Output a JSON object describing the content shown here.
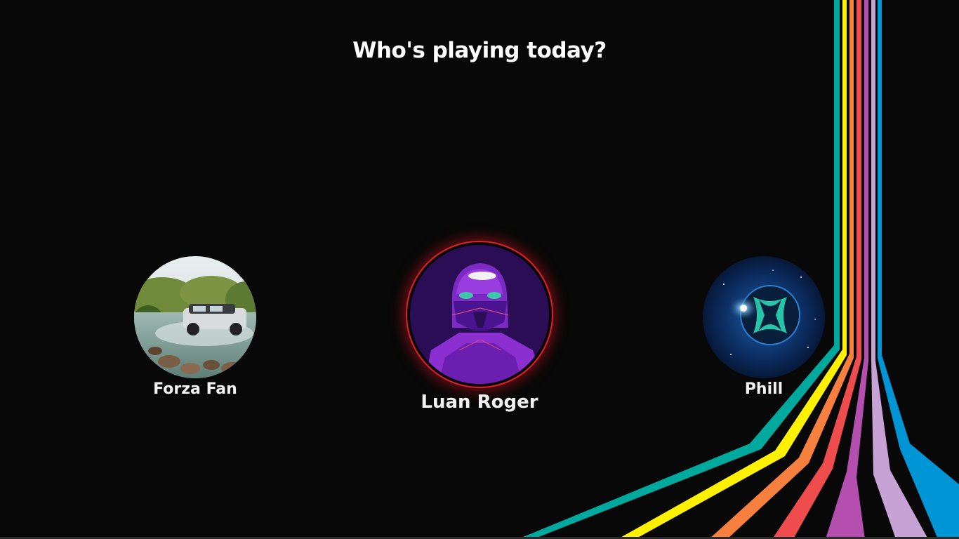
{
  "screen": {
    "title": "Who's playing today?"
  },
  "profiles": [
    {
      "name": "Forza Fan",
      "avatar": "off-road-car-photo",
      "selected": false
    },
    {
      "name": "Luan Roger",
      "avatar": "purple-helmet-art",
      "selected": true
    },
    {
      "name": "Phill",
      "avatar": "xbox-logo-space",
      "selected": false
    }
  ],
  "colors": {
    "background": "#080808",
    "selection_ring": "#e0202a",
    "stripes": [
      "#00a99d",
      "#fff100",
      "#f7803f",
      "#ef4d4d",
      "#b44fb0",
      "#c6a3d4",
      "#0096d6"
    ]
  }
}
